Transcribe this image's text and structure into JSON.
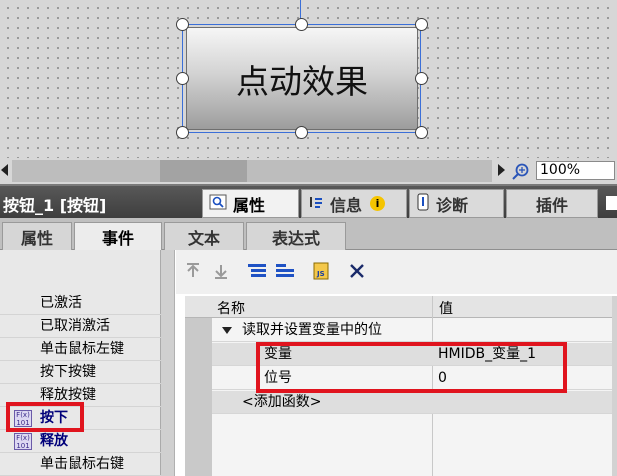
{
  "canvas": {
    "button_text": "点动效果"
  },
  "zoom": {
    "value": "100%"
  },
  "inspector": {
    "title": "按钮_1 [按钮]",
    "tabs": [
      {
        "label": "属性",
        "icon": "properties-icon"
      },
      {
        "label": "信息",
        "icon": "info-icon"
      },
      {
        "label": "诊断",
        "icon": "diagnostics-icon"
      },
      {
        "label": "插件",
        "icon": ""
      }
    ]
  },
  "subtabs": [
    "属性",
    "事件",
    "文本",
    "表达式"
  ],
  "events": [
    {
      "label": "已激活",
      "bold": false
    },
    {
      "label": "已取消激活",
      "bold": false
    },
    {
      "label": "单击鼠标左键",
      "bold": false
    },
    {
      "label": "按下按键",
      "bold": false
    },
    {
      "label": "释放按键",
      "bold": false
    },
    {
      "label": "按下",
      "bold": true
    },
    {
      "label": "释放",
      "bold": true
    },
    {
      "label": "单击鼠标右键",
      "bold": false
    }
  ],
  "table": {
    "headers": {
      "name": "名称",
      "value": "值"
    },
    "function_name": "读取并设置变量中的位",
    "params": [
      {
        "name": "变量",
        "value": "HMIDB_变量_1"
      },
      {
        "name": "位号",
        "value": "0"
      }
    ],
    "add_function": "<添加函数>"
  },
  "colors": {
    "highlight": "#e0141e",
    "selection": "#3b6fd8"
  }
}
